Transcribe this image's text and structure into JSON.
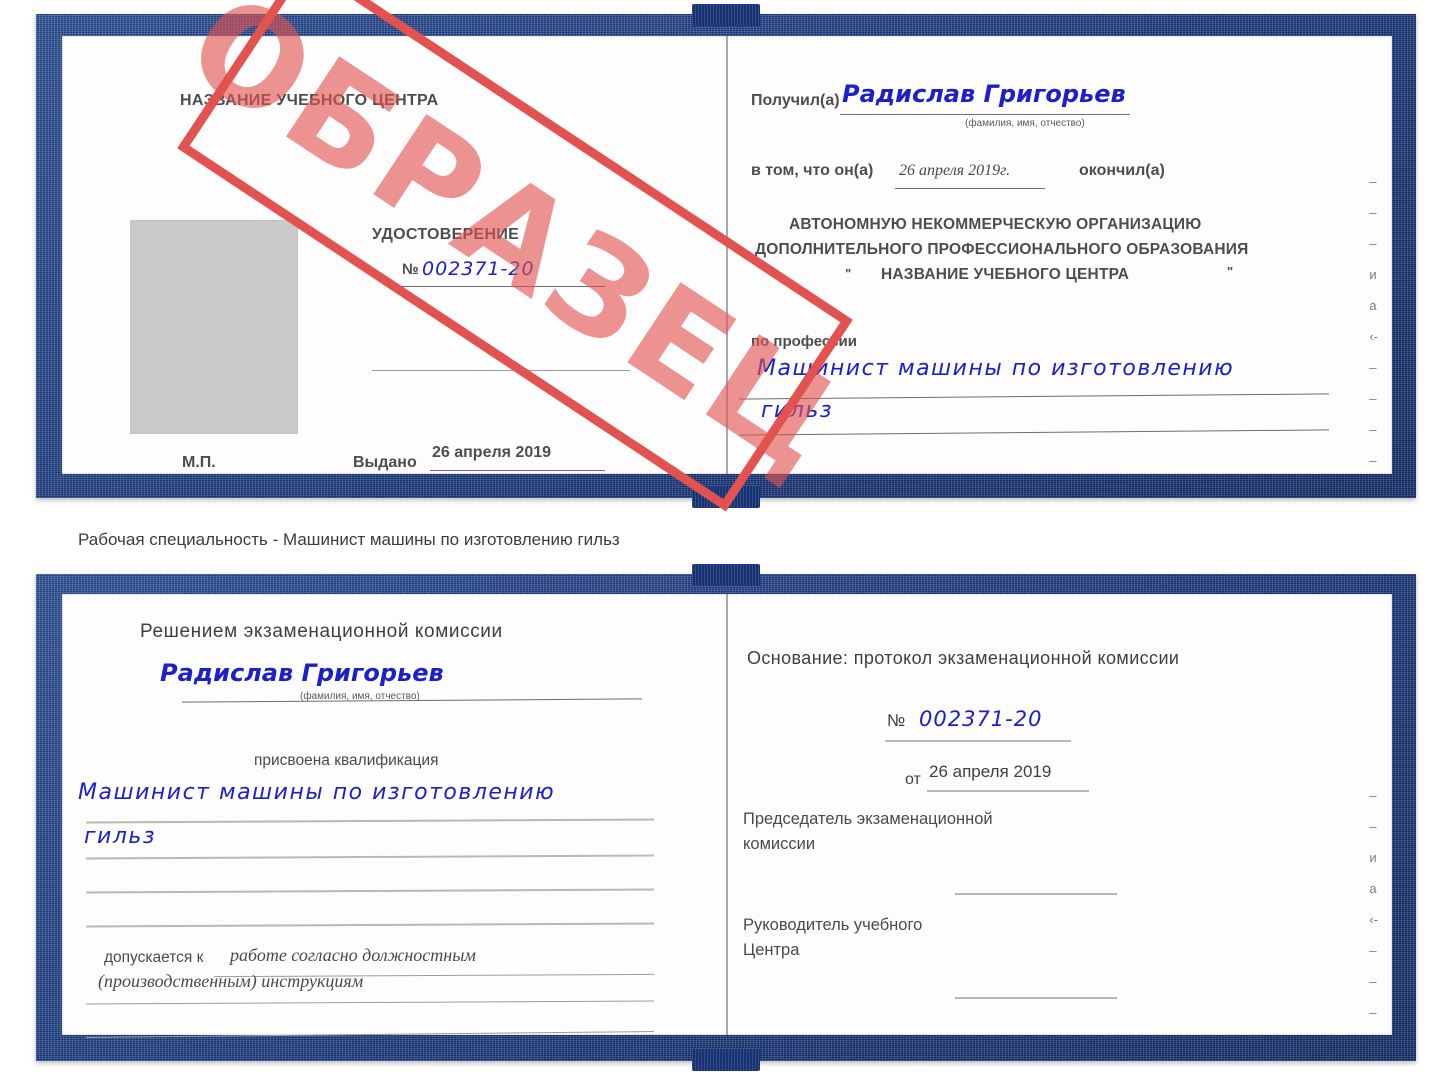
{
  "document": {
    "kind": "certificate-scan",
    "caption": "Рабочая специальность - Машинист машины по изготовлению гильз",
    "stamp_label": "ОБРАЗЕЦ",
    "stamp_color": "#e2524f",
    "cover_color": "#21479b",
    "ink_color": "#1d20c8"
  },
  "top_certificate": {
    "left_page": {
      "org_title": "НАЗВАНИЕ УЧЕБНОГО ЦЕНТРА",
      "doc_title": "УДОСТОВЕРЕНИЕ",
      "number_label": "№",
      "number_value": "002371-20",
      "issued_label": "Выдано",
      "issued_value": "26 апреля 2019",
      "seal_label": "М.П.",
      "photo_placeholder": "photo-area"
    },
    "right_page": {
      "received_label": "Получил(а)",
      "received_value": "Радислав Григорьев",
      "fio_hint": "(фамилия, имя, отчество)",
      "that_he_label": "в том, что он(а)",
      "completion_date": "26 апреля 2019г.",
      "finished_label": "окончил(а)",
      "org_line_1": "АВТОНОМНУЮ НЕКОММЕРЧЕСКУЮ ОРГАНИЗАЦИЮ",
      "org_line_2": "ДОПОЛНИТЕЛЬНОГО ПРОФЕССИОНАЛЬНОГО ОБРАЗОВАНИЯ",
      "org_quote_open": "\"",
      "org_line_3": "НАЗВАНИЕ УЧЕБНОГО ЦЕНТРА",
      "org_quote_close": "\"",
      "profession_label": "по профессии",
      "profession_value_line1": "Машинист машины по изготовлению",
      "profession_value_line2": "гильз",
      "margin_marks": [
        "–",
        "–",
        "–",
        "и",
        "а",
        "‹-",
        "–",
        "–",
        "–",
        "–"
      ]
    }
  },
  "bottom_certificate": {
    "left_page": {
      "heading": "Решением экзаменационной комиссии",
      "name_value": "Радислав Григорьев",
      "fio_hint": "(фамилия, имя, отчество)",
      "qualification_label": "присвоена квалификация",
      "qualification_line1": "Машинист машины по изготовлению",
      "qualification_line2": "гильз",
      "admitted_label": "допускается к",
      "admitted_value_line1": "работе согласно должностным",
      "admitted_value_line2": "(производственным) инструкциям"
    },
    "right_page": {
      "basis_label": "Основание: протокол экзаменационной комиссии",
      "number_label": "№",
      "number_value": "002371-20",
      "date_label": "от",
      "date_value": "26 апреля 2019",
      "chairman_line1": "Председатель экзаменационной",
      "chairman_line2": "комиссии",
      "head_line1": "Руководитель учебного",
      "head_line2": "Центра",
      "margin_marks": [
        "–",
        "–",
        "и",
        "а",
        "‹-",
        "–",
        "–",
        "–"
      ]
    }
  }
}
